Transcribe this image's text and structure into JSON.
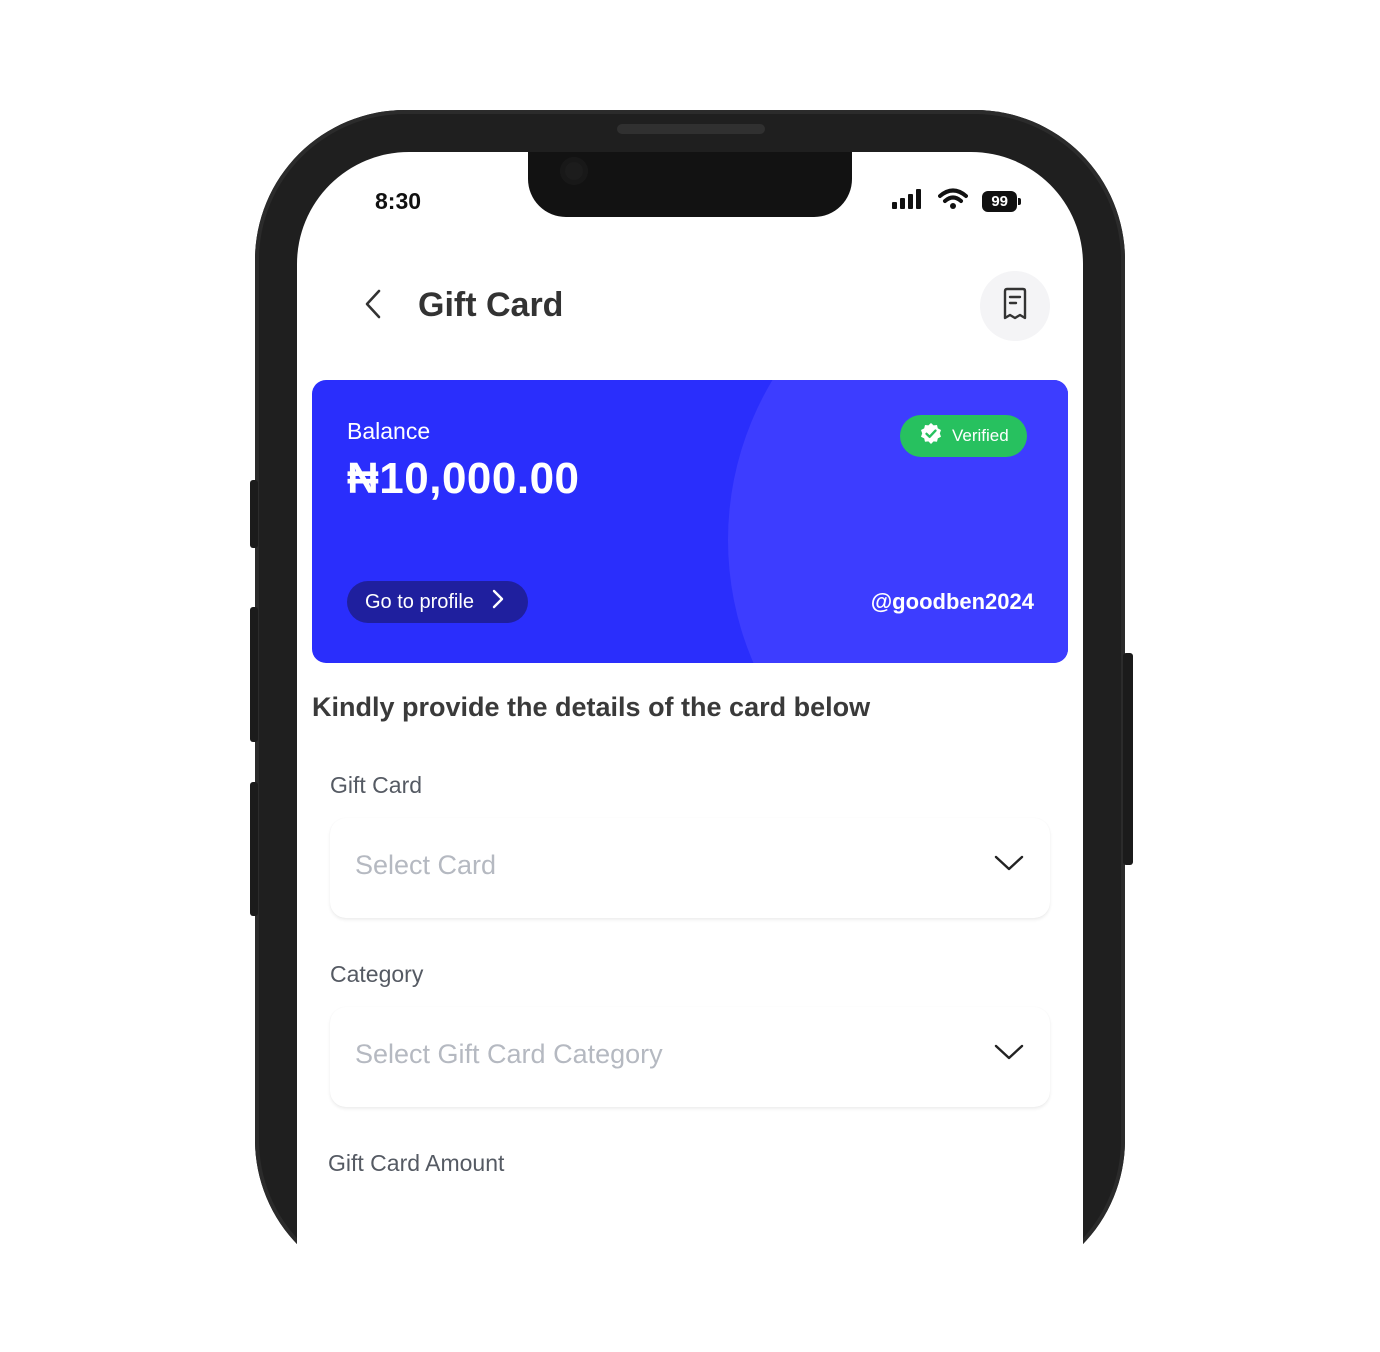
{
  "status_bar": {
    "time": "8:30",
    "battery": "99"
  },
  "header": {
    "title": "Gift Card"
  },
  "balance_card": {
    "label": "Balance",
    "amount": "₦10,000.00",
    "verified_label": "Verified",
    "profile_button": "Go to profile",
    "username": "@goodben2024"
  },
  "form": {
    "instruction": "Kindly provide the details of the card below",
    "gift_card": {
      "label": "Gift Card",
      "placeholder": "Select Card"
    },
    "category": {
      "label": "Category",
      "placeholder": "Select Gift Card Category"
    },
    "amount": {
      "label": "Gift Card Amount"
    }
  },
  "colors": {
    "card_primary": "#2a2efc",
    "card_arc": "#3d3dff",
    "verified_green": "#27c15f",
    "profile_button_bg": "#1f1f9e"
  },
  "icons": [
    "back-chevron-icon",
    "receipt-icon",
    "verified-check-icon",
    "chevron-right-icon",
    "chevron-down-icon",
    "signal-icon",
    "wifi-icon"
  ]
}
